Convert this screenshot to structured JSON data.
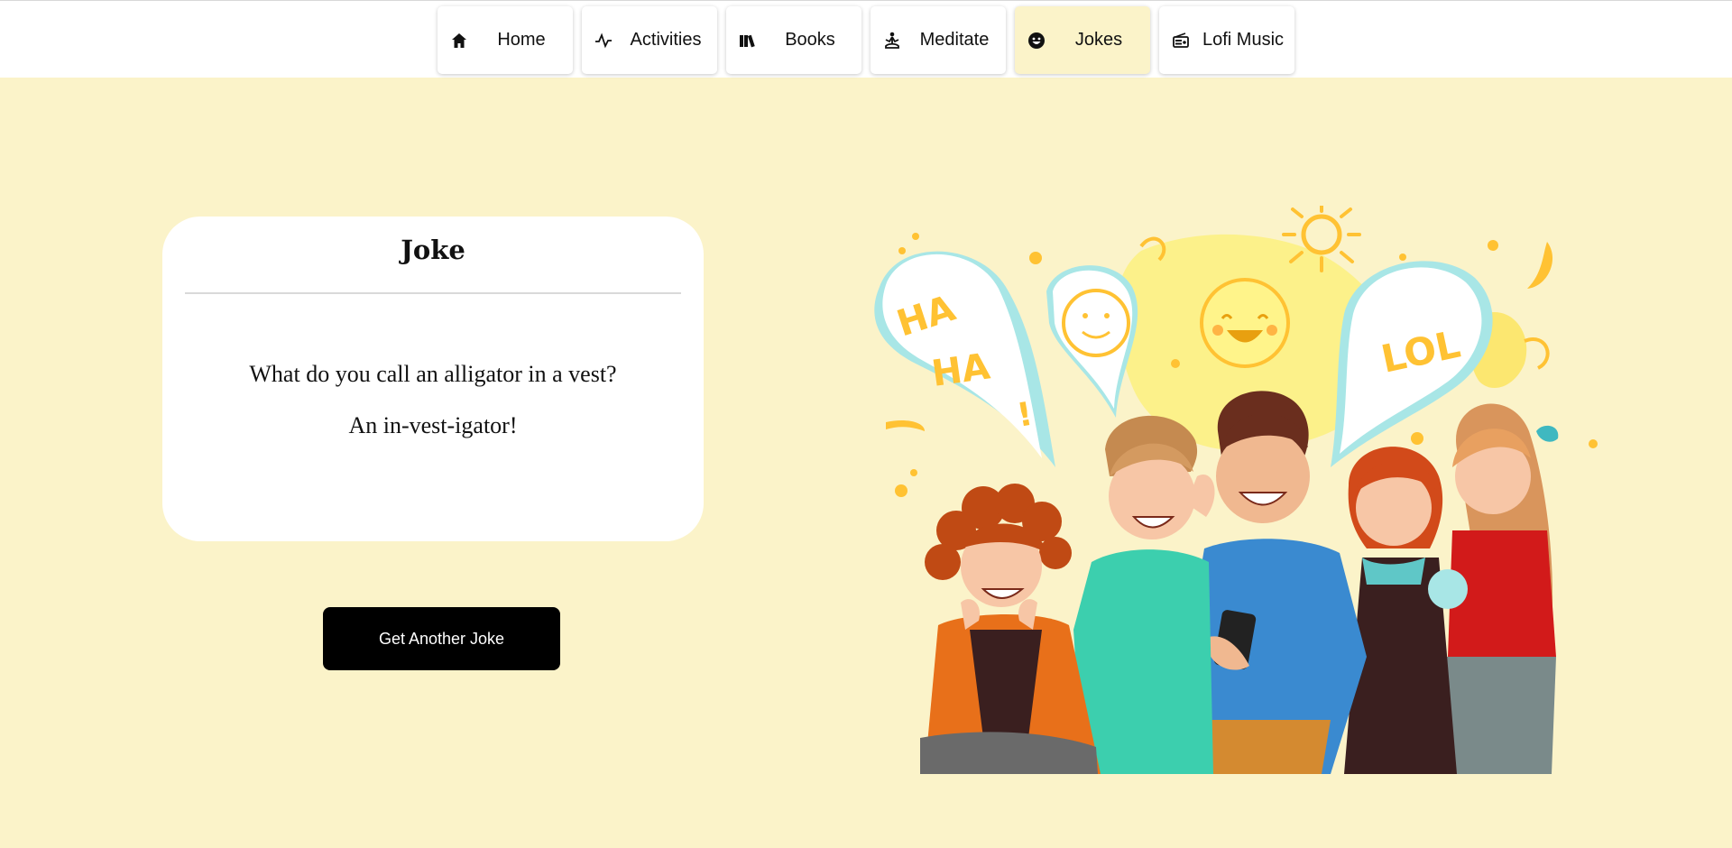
{
  "nav": {
    "items": [
      {
        "label": "Home",
        "icon": "home-icon",
        "active": false
      },
      {
        "label": "Activities",
        "icon": "activity-pulse-icon",
        "active": false
      },
      {
        "label": "Books",
        "icon": "books-icon",
        "active": false
      },
      {
        "label": "Meditate",
        "icon": "meditate-icon",
        "active": false
      },
      {
        "label": "Jokes",
        "icon": "smile-icon",
        "active": true
      },
      {
        "label": "Lofi Music",
        "icon": "radio-icon",
        "active": false
      }
    ]
  },
  "joke": {
    "title": "Joke",
    "setup": "What do you call an alligator in a vest?",
    "punchline": "An in-vest-igator!"
  },
  "actions": {
    "another_label": "Get Another Joke"
  },
  "illustration": {
    "bubble_left_text": "HA HA !",
    "bubble_right_text": "LOL"
  },
  "colors": {
    "page_bg": "#fbf3c9",
    "active_tab_bg": "#fbf3c9",
    "card_bg": "#ffffff",
    "button_bg": "#000000"
  }
}
